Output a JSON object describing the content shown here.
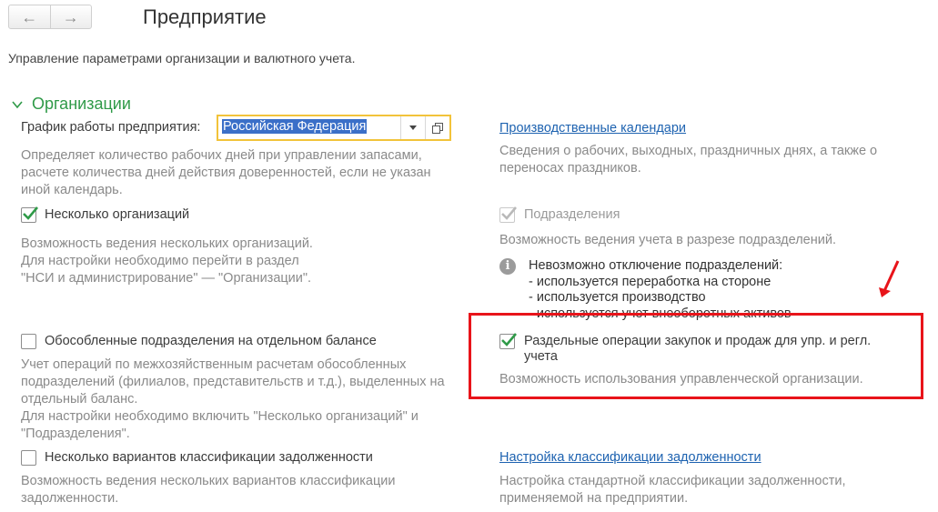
{
  "nav": {
    "back_icon": "arrow-left-icon",
    "forward_icon": "arrow-right-icon",
    "back": "←",
    "forward": "→"
  },
  "header": {
    "title": "Предприятие",
    "subtitle": "Управление параметрами организации и валютного учета."
  },
  "section": {
    "title": "Организации",
    "icon": "chevron-down-icon"
  },
  "work_schedule": {
    "label": "График работы предприятия:",
    "value": "Российская Федерация",
    "description_lines": [
      "Определяет количество рабочих дней при управлении запасами,",
      "расчете количества дней действия доверенностей, если не указан",
      "иной календарь."
    ]
  },
  "production_calendars": {
    "link": "Производственные календари",
    "description_lines": [
      "Сведения о рабочих, выходных, праздничных днях, а также о",
      "переносах праздников."
    ]
  },
  "multiple_orgs": {
    "label": "Несколько организаций",
    "checked": true,
    "description_lines": [
      "Возможность ведения нескольких организаций.",
      "Для настройки необходимо перейти в раздел",
      "\"НСИ и администрирование\" — \"Организации\"."
    ]
  },
  "departments": {
    "label": "Подразделения",
    "checked": true,
    "disabled": true,
    "description": "Возможность ведения учета в разрезе подразделений."
  },
  "info": {
    "lines": [
      "Невозможно отключение подразделений:",
      "- используется переработка на стороне",
      "- используется производство",
      "- используется учет внеоборотных активов"
    ]
  },
  "separate_subdivisions": {
    "label": "Обособленные подразделения на отдельном балансе",
    "checked": false,
    "description_lines": [
      "Учет операций по межхозяйственным расчетам обособленных",
      "подразделений (филиалов, представительств и т.д.), выделенных на",
      "отдельный баланс.",
      "Для настройки необходимо включить \"Несколько организаций\" и",
      "\"Подразделения\"."
    ]
  },
  "separate_operations": {
    "label_lines": [
      "Раздельные операции закупок и продаж для упр. и регл.",
      "учета"
    ],
    "checked": true,
    "description": "Возможность использования управленческой организации."
  },
  "debt_classification": {
    "label": "Несколько вариантов классификации задолженности",
    "checked": false,
    "description_lines": [
      "Возможность ведения нескольких вариантов классификации",
      "задолженности."
    ]
  },
  "debt_settings": {
    "link": "Настройка классификации задолженности",
    "description_lines": [
      "Настройка стандартной классификации задолженности,",
      "применяемой на предприятии."
    ]
  },
  "colors": {
    "accent_green": "#2f9a48",
    "link_blue": "#1d62b0",
    "highlight_red": "#e8141a",
    "combo_border": "#f2c33a"
  }
}
